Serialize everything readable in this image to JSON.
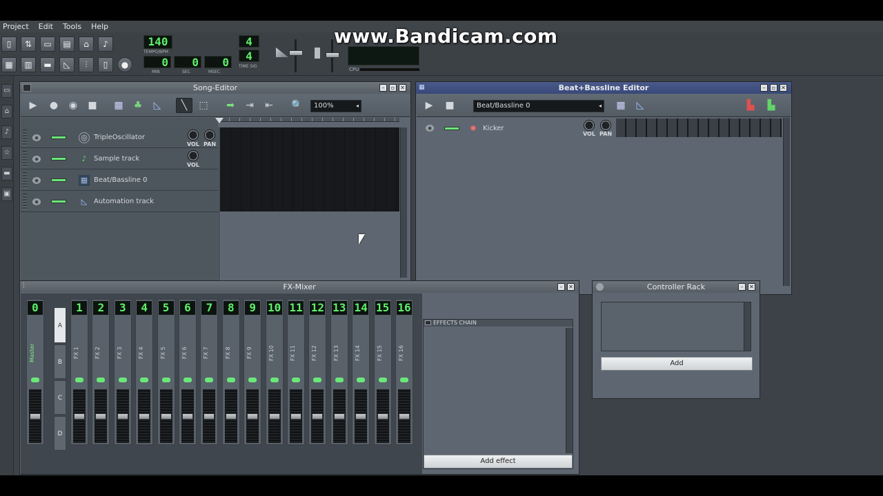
{
  "watermark": "www.Bandicam.com",
  "menu": [
    "Project",
    "Edit",
    "Tools",
    "Help"
  ],
  "transport": {
    "tempo": "140",
    "tempo_label": "TEMPO/BPM",
    "min": "0",
    "sec": "0",
    "msec": "0",
    "min_label": "MIN",
    "sec_label": "SEC",
    "msec_label": "MSEC",
    "timesig_num": "4",
    "timesig_den": "4",
    "timesig_label": "TIME SIG",
    "cpu_label": "CPU"
  },
  "song_editor": {
    "title": "Song-Editor",
    "zoom": "100%",
    "tracks": [
      {
        "name": "TripleOscillator",
        "icon": "oscillator-icon"
      },
      {
        "name": "Sample track",
        "icon": "sample-icon"
      },
      {
        "name": "Beat/Bassline 0",
        "icon": "beat-bassline-icon"
      },
      {
        "name": "Automation track",
        "icon": "automation-icon"
      }
    ],
    "vol_label": "VOL",
    "pan_label": "PAN"
  },
  "bb_editor": {
    "title": "Beat+Bassline Editor",
    "selected": "Beat/Bassline 0",
    "track": "Kicker",
    "vol_label": "VOL",
    "pan_label": "PAN"
  },
  "fx_mixer": {
    "title": "FX-Mixer",
    "master_num": "0",
    "master_label": "Master",
    "channels": [
      "1",
      "2",
      "3",
      "4",
      "5",
      "6",
      "7",
      "8",
      "9",
      "10",
      "11",
      "12",
      "13",
      "14",
      "15",
      "16"
    ],
    "channel_labels": [
      "FX 1",
      "FX 2",
      "FX 3",
      "FX 4",
      "FX 5",
      "FX 6",
      "FX 7",
      "FX 8",
      "FX 9",
      "FX 10",
      "FX 11",
      "FX 12",
      "FX 13",
      "FX 14",
      "FX 15",
      "FX 16"
    ],
    "banks": [
      "A",
      "B",
      "C",
      "D"
    ],
    "effects_chain": "EFFECTS CHAIN",
    "add_effect": "Add effect"
  },
  "controller_rack": {
    "title": "Controller Rack",
    "add": "Add"
  }
}
